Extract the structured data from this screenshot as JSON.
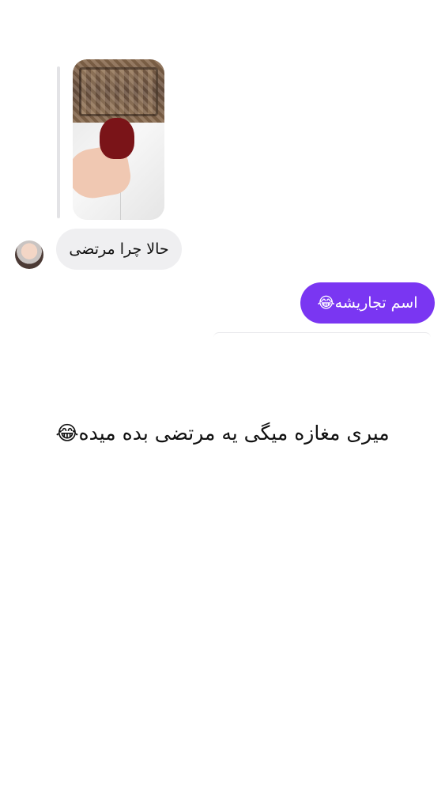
{
  "conversation": {
    "media_message": {
      "description": "photo-thumbnail"
    },
    "incoming_message": {
      "text": "حالا چرا مرتضی"
    },
    "outgoing_message": {
      "text": "اسم تجاریشه😂"
    }
  },
  "caption": {
    "text": "میری مغازه میگی یه مرتضی بده میده😂"
  },
  "colors": {
    "outgoing_bubble": "#7a36f2",
    "incoming_bubble": "#efeff1",
    "background": "#ffffff"
  }
}
